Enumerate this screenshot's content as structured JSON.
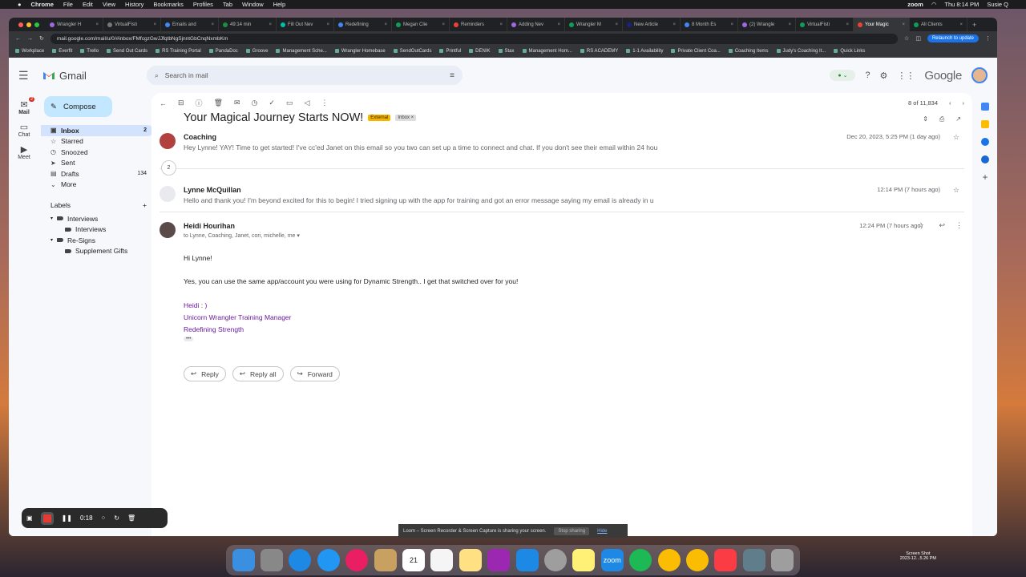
{
  "menubar": {
    "app": "Chrome",
    "items": [
      "File",
      "Edit",
      "View",
      "History",
      "Bookmarks",
      "Profiles",
      "Tab",
      "Window",
      "Help"
    ],
    "clock": "Thu 8:14 PM",
    "user": "Susie Q",
    "zoom": "zoom"
  },
  "browser": {
    "tabs": [
      {
        "label": "Wrangler H",
        "color": "#9c6ade"
      },
      {
        "label": "VirtualFisti",
        "color": "#777"
      },
      {
        "label": "Emails and",
        "color": "#4285f4"
      },
      {
        "label": "49:14 min",
        "color": "#1e8e3e"
      },
      {
        "label": "Fill Out Nev",
        "color": "#00bfa5"
      },
      {
        "label": "Redefining",
        "color": "#4285f4"
      },
      {
        "label": "Megan Clie",
        "color": "#0f9d58"
      },
      {
        "label": "Reminders",
        "color": "#ea4335"
      },
      {
        "label": "Adding Nev",
        "color": "#9c6ade"
      },
      {
        "label": "Wrangler M",
        "color": "#0f9d58"
      },
      {
        "label": "New Article",
        "color": "#1a237e"
      },
      {
        "label": "8 Month Es",
        "color": "#4285f4"
      },
      {
        "label": "(2) Wrangle",
        "color": "#9c6ade"
      },
      {
        "label": "VirtualFisti",
        "color": "#0f9d58"
      },
      {
        "label": "Your Magic",
        "color": "#ea4335",
        "active": true
      },
      {
        "label": "All Clients",
        "color": "#0f9d58"
      }
    ],
    "url": "mail.google.com/mail/u/0/#inbox/FMfcgzGwJJfqtbNgSjnntGbCnqNxmbKm",
    "relaunch": "Relaunch to update",
    "bookmarks": [
      "Workplace",
      "Everfit",
      "Trello",
      "Send Out Cards",
      "RS Training Portal",
      "PandaDoc",
      "Groove",
      "Management Sche...",
      "Wrangler Homebase",
      "SendOutCards",
      "Printful",
      "DENIK",
      "Stax",
      "Management Hom...",
      "RS ACADEMY",
      "1-1 Availability",
      "Private Client Coa...",
      "Coaching Items",
      "Judy's Coaching It...",
      "Quick Links"
    ]
  },
  "gmail": {
    "brand": "Gmail",
    "search_placeholder": "Search in mail",
    "google_logo": "Google",
    "rail": {
      "mail": "Mail",
      "mail_badge": "2",
      "chat": "Chat",
      "meet": "Meet"
    },
    "compose": "Compose",
    "nav": [
      {
        "label": "Inbox",
        "count": "2",
        "selected": true,
        "icon": "inbox-icon",
        "glyph": "▣"
      },
      {
        "label": "Starred",
        "count": "",
        "icon": "star-icon",
        "glyph": "☆"
      },
      {
        "label": "Snoozed",
        "count": "",
        "icon": "clock-icon",
        "glyph": "◷"
      },
      {
        "label": "Sent",
        "count": "",
        "icon": "send-icon",
        "glyph": "➤"
      },
      {
        "label": "Drafts",
        "count": "134",
        "icon": "draft-icon",
        "glyph": "▤"
      },
      {
        "label": "More",
        "count": "",
        "icon": "chevron-down-icon",
        "glyph": "⌄"
      }
    ],
    "labels_title": "Labels",
    "labels": [
      {
        "label": "Interviews",
        "indent": 0,
        "caret": true
      },
      {
        "label": "Interviews",
        "indent": 1,
        "caret": false
      },
      {
        "label": "Re-Signs",
        "indent": 0,
        "caret": true
      },
      {
        "label": "Supplement Gifts",
        "indent": 1,
        "caret": false
      }
    ],
    "pager": "8 of 11,834",
    "subject": "Your Magical Journey Starts NOW!",
    "tag_external": "External",
    "tag_inbox": "Inbox",
    "collapsed_count": "2",
    "messages": [
      {
        "from": "Coaching",
        "snippet": "Hey Lynne! YAY! Time to get started! I've cc'ed Janet on this email so you two can set up a time to connect and chat. If you don't see their email within 24 hou",
        "date": "Dec 20, 2023, 5:25 PM (1 day ago)"
      },
      {
        "from": "Lynne McQuillan",
        "snippet": "Hello and thank you! I'm beyond excited for this to begin! I tried signing up with the app for training and got an error message saying my email is already in u",
        "date": "12:14 PM (7 hours ago)"
      }
    ],
    "open_message": {
      "from": "Heidi Hourihan",
      "to": "to Lynne, Coaching, Janet, cori, michelle, me",
      "date": "12:24 PM (7 hours ago)",
      "greeting": "Hi Lynne!",
      "body": "Yes, you can use the same app/account you were using for Dynamic Strength.. I get that switched over for you!",
      "sig1": "Heidi : )",
      "sig2": "Unicorn Wrangler Training Manager",
      "sig3": "Redefining Strength",
      "ellipsis": "•••"
    },
    "reply": "Reply",
    "reply_all": "Reply all",
    "forward": "Forward"
  },
  "loom": {
    "time": "0:18",
    "share_text": "Loom – Screen Recorder & Screen Capture is sharing your screen.",
    "stop": "Stop sharing",
    "hide": "Hide"
  },
  "desktop": {
    "screenshot_label": "Screen Shot",
    "screenshot_date": "2023-12...5.26 PM"
  }
}
